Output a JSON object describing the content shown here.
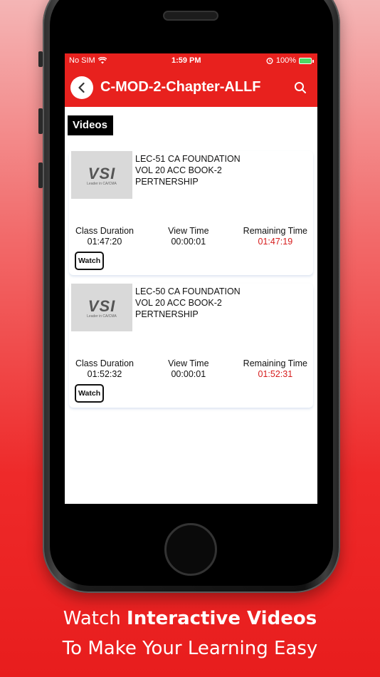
{
  "status": {
    "carrier": "No SIM",
    "time": "1:59 PM",
    "battery": "100%"
  },
  "appbar": {
    "title": "C-MOD-2-Chapter-ALLF"
  },
  "section": {
    "label": "Videos"
  },
  "videos": [
    {
      "title": "LEC-51 CA FOUNDATION VOL 20 ACC  BOOK-2 PERTNERSHIP",
      "thumb_logo": "VSI",
      "thumb_tag": "Leader in CA/CMA",
      "class_duration_label": "Class Duration",
      "class_duration": "01:47:20",
      "view_time_label": "View Time",
      "view_time": "00:00:01",
      "remaining_label": "Remaining Time",
      "remaining": "01:47:19",
      "watch_label": "Watch"
    },
    {
      "title": "LEC-50 CA FOUNDATION VOL 20 ACC  BOOK-2 PERTNERSHIP",
      "thumb_logo": "VSI",
      "thumb_tag": "Leader in CA/CMA",
      "class_duration_label": "Class Duration",
      "class_duration": "01:52:32",
      "view_time_label": "View Time",
      "view_time": "00:00:01",
      "remaining_label": "Remaining Time",
      "remaining": "01:52:31",
      "watch_label": "Watch"
    }
  ],
  "caption": {
    "line1_prefix": "Watch ",
    "line1_bold": "Interactive Videos",
    "line2": "To Make Your Learning Easy"
  },
  "colors": {
    "accent": "#e8211e",
    "remaining": "#d61c1c"
  },
  "icons": {
    "back": "chevron-left-icon",
    "search": "search-icon",
    "wifi": "wifi-icon",
    "alarm": "alarm-icon",
    "battery": "battery-icon"
  }
}
